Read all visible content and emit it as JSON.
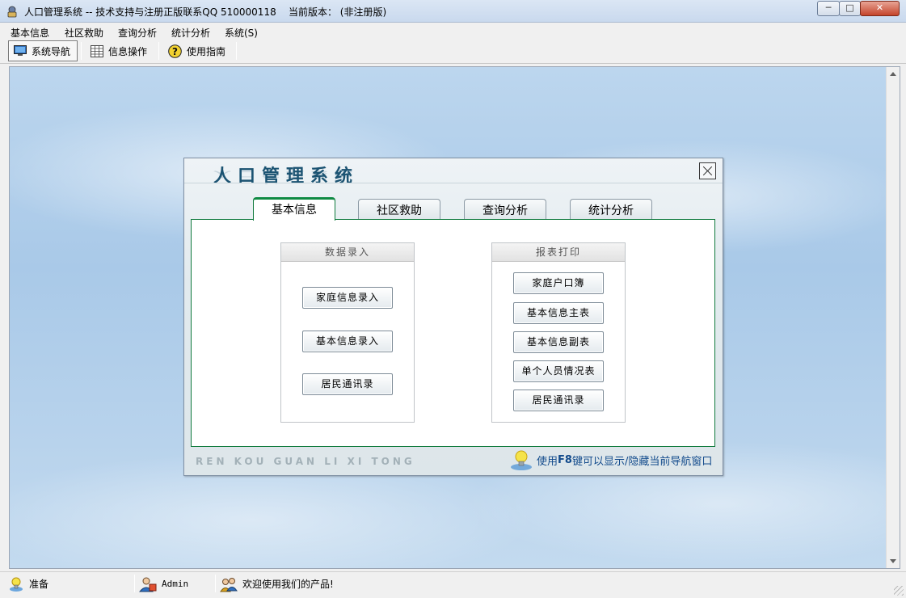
{
  "window": {
    "title": "人口管理系统 -- 技术支持与注册正版联系QQ 510000118    当前版本： (非注册版)",
    "controls": {
      "minimize": "─",
      "maximize": "□",
      "close": "✕"
    }
  },
  "menu": [
    "基本信息",
    "社区救助",
    "查询分析",
    "统计分析",
    "系统(S)"
  ],
  "toolbar": [
    {
      "label": "系统导航",
      "icon": "monitor-icon",
      "active": true
    },
    {
      "label": "信息操作",
      "icon": "grid-icon",
      "active": false
    },
    {
      "label": "使用指南",
      "icon": "help-icon",
      "active": false
    }
  ],
  "nav": {
    "title": "人口管理系统",
    "tabs": [
      "基本信息",
      "社区救助",
      "查询分析",
      "统计分析"
    ],
    "active_tab": 0,
    "groups": {
      "data_entry": {
        "title": "数据录入",
        "buttons": [
          "家庭信息录入",
          "基本信息录入",
          "居民通讯录"
        ]
      },
      "report_print": {
        "title": "报表打印",
        "buttons": [
          "家庭户口簿",
          "基本信息主表",
          "基本信息副表",
          "单个人员情况表",
          "居民通讯录"
        ]
      }
    },
    "brand": "REN KOU GUAN LI XI TONG",
    "hint": {
      "prefix": "使用",
      "key": "F8",
      "suffix": "键可以显示/隐藏当前导航窗口"
    }
  },
  "status": {
    "state": "准备",
    "user": "Admin",
    "message": "欢迎使用我们的产品!"
  },
  "colors": {
    "accent_green": "#0f8a43",
    "title_blue": "#1b5372",
    "hint_blue": "#134b8c"
  }
}
